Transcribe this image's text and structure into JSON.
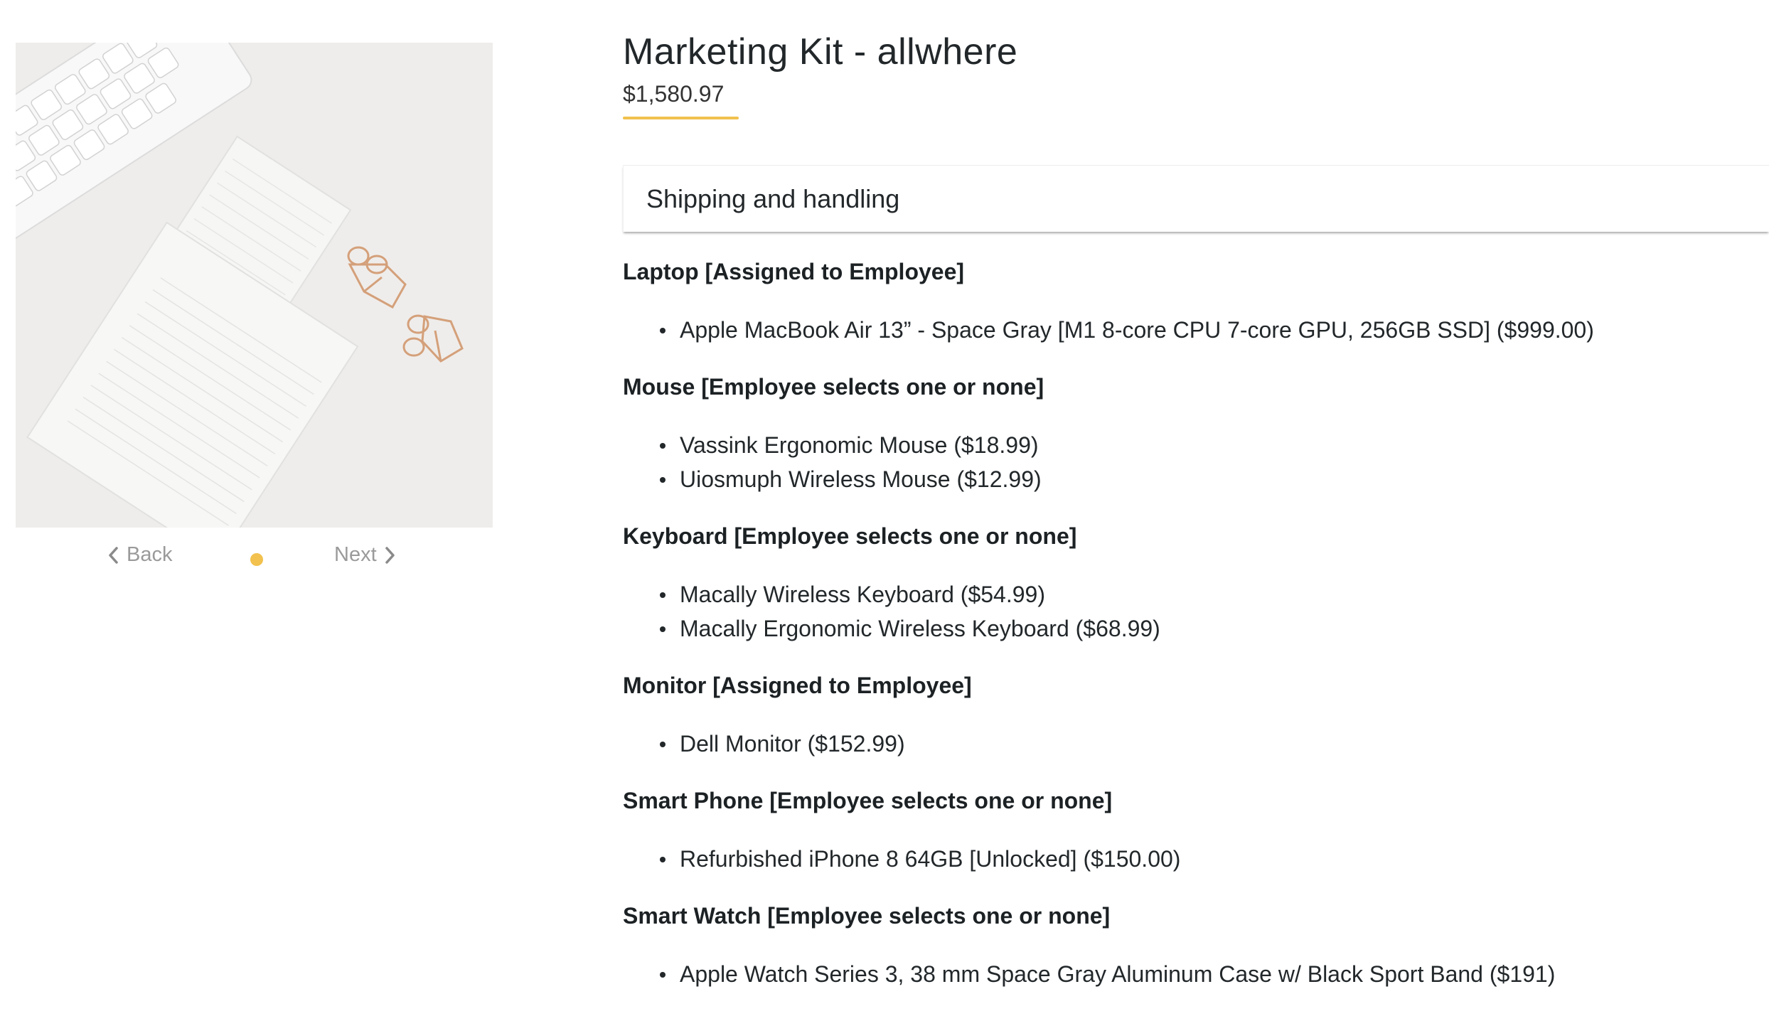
{
  "product": {
    "title": "Marketing Kit - allwhere",
    "price": "$1,580.97",
    "accent_color": "#f2c14e"
  },
  "carousel": {
    "back_label": "Back",
    "next_label": "Next",
    "slide_count": 1,
    "active_slide": 1,
    "image_icon": "notepad-photo"
  },
  "tabs": {
    "shipping_label": "Shipping and handling"
  },
  "sections": [
    {
      "heading": "Laptop [Assigned to Employee]",
      "items": [
        "Apple MacBook Air 13” - Space Gray [M1 8-core CPU 7-core GPU, 256GB SSD] ($999.00)"
      ]
    },
    {
      "heading": "Mouse [Employee selects one or none]",
      "items": [
        "Vassink Ergonomic Mouse ($18.99)",
        "Uiosmuph Wireless Mouse ($12.99)"
      ]
    },
    {
      "heading": "Keyboard [Employee selects one or none]",
      "items": [
        "Macally Wireless Keyboard ($54.99)",
        "Macally Ergonomic Wireless Keyboard ($68.99)"
      ]
    },
    {
      "heading": "Monitor [Assigned to Employee]",
      "items": [
        "Dell Monitor ($152.99)"
      ]
    },
    {
      "heading": "Smart Phone [Employee selects one or none]",
      "items": [
        "Refurbished iPhone 8 64GB [Unlocked] ($150.00)"
      ]
    },
    {
      "heading": "Smart Watch [Employee selects one or none]",
      "items": [
        "Apple Watch Series 3, 38 mm Space Gray Aluminum Case w/ Black Sport Band ($191)"
      ]
    }
  ]
}
